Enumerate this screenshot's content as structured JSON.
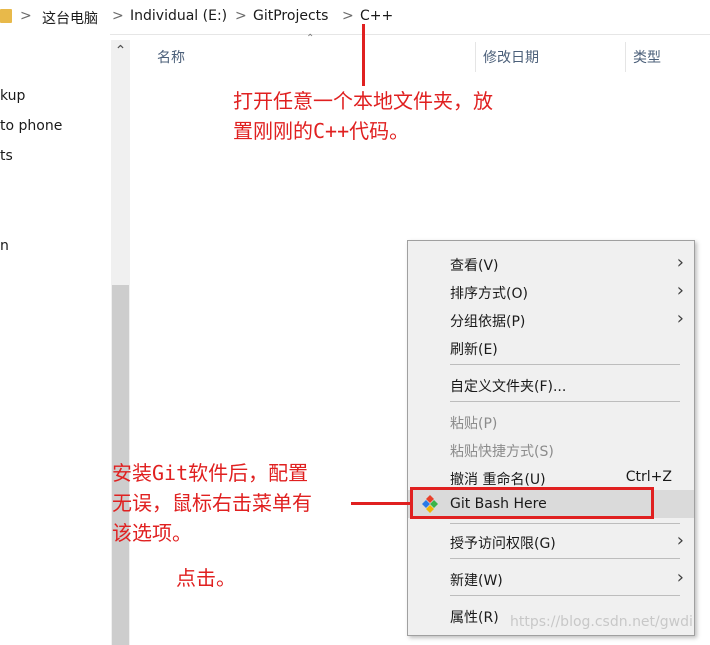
{
  "breadcrumb": {
    "items": [
      "这台电脑",
      "Individual (E:)",
      "GitProjects",
      "C++"
    ],
    "separator": ">"
  },
  "nav": {
    "items": [
      "kup",
      "to phone",
      "ts",
      "n"
    ]
  },
  "columns": {
    "name": "名称",
    "modified": "修改日期",
    "type": "类型"
  },
  "context_menu": {
    "view": "查看(V)",
    "sort": "排序方式(O)",
    "group": "分组依据(P)",
    "refresh": "刷新(E)",
    "customize": "自定义文件夹(F)...",
    "paste": "粘贴(P)",
    "paste_shortcut": "粘贴快捷方式(S)",
    "undo": "撤消 重命名(U)",
    "undo_shortcut": "Ctrl+Z",
    "git_bash": "Git Bash Here",
    "grant_access": "授予访问权限(G)",
    "new": "新建(W)",
    "properties": "属性(R)"
  },
  "annotations": {
    "top_line1": "打开任意一个本地文件夹，放",
    "top_line2": "置刚刚的C++代码。",
    "left_line1": "安装Git软件后，配置",
    "left_line2": "无误，鼠标右击菜单有",
    "left_line3": "该选项。",
    "click": "点击。"
  },
  "watermark": "https://blog.csdn.net/gwdi",
  "colors": {
    "annotation": "#e02020",
    "menu_bg": "#f0f0f0",
    "highlight": "#dadada"
  }
}
